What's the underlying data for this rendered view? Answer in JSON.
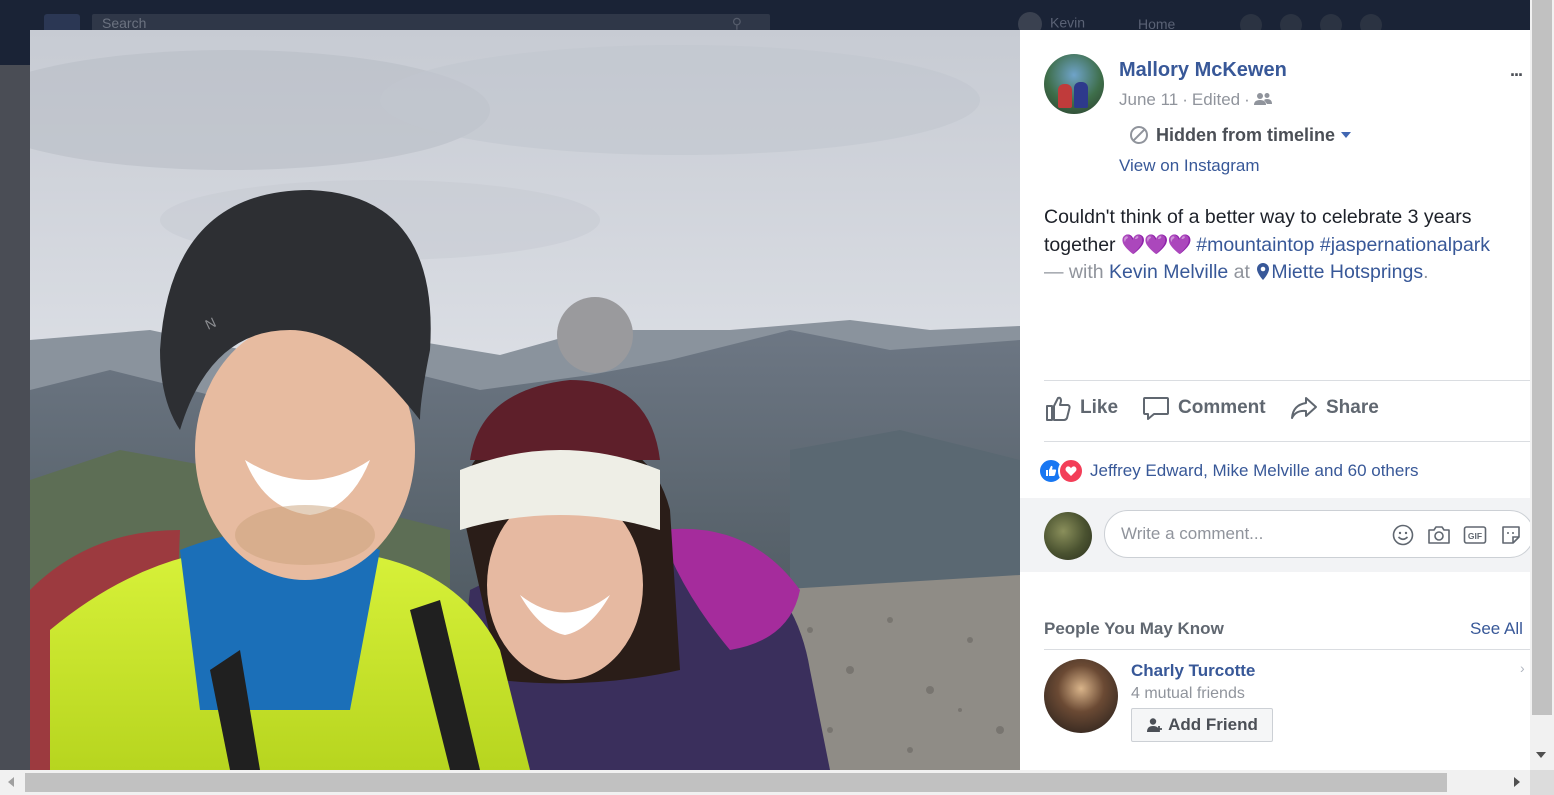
{
  "background_bar": {
    "search_placeholder": "Search",
    "profile_name": "Kevin",
    "home_label": "Home"
  },
  "post": {
    "author": "Mallory McKewen",
    "date": "June 11",
    "edited_label": "Edited",
    "audience_icon": "friends-icon",
    "more_label": "...",
    "timeline_status": "Hidden from timeline",
    "view_on_instagram": "View on Instagram",
    "text_line1": "Couldn't think of a better way to celebrate 3 years",
    "text_together": "together",
    "hearts": "💜💜💜",
    "hashtag1": "#mountaintop",
    "hashtag2": "#jaspernationalpark",
    "with_prefix": "— with",
    "tagged_person": "Kevin Melville",
    "at_label": "at",
    "location": "Miette Hotsprings",
    "period": "."
  },
  "actions": {
    "like": "Like",
    "comment": "Comment",
    "share": "Share"
  },
  "reactions": {
    "summary": "Jeffrey Edward, Mike Melville and 60 others"
  },
  "comment_box": {
    "placeholder": "Write a comment..."
  },
  "pymk": {
    "title": "People You May Know",
    "see_all": "See All",
    "person": {
      "name": "Charly Turcotte",
      "mutual": "4 mutual friends",
      "add_friend": "Add Friend"
    }
  },
  "colors": {
    "link": "#385898",
    "secondary_text": "#90949c",
    "like_blue": "#1877f2",
    "love_red": "#f33e58",
    "hearts_purple": "#8f5bd6"
  }
}
